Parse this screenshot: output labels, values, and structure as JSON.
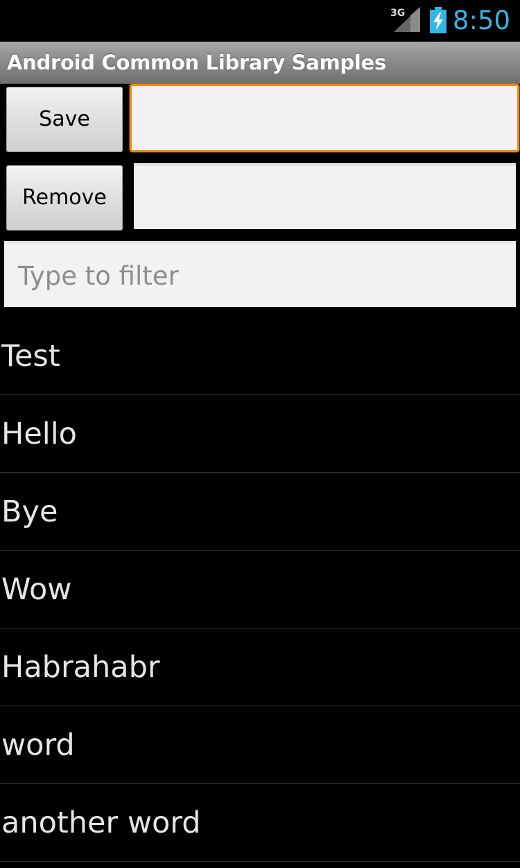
{
  "status_bar": {
    "network": "3G",
    "time": "8:50"
  },
  "app": {
    "title": "Android Common Library Samples"
  },
  "controls": {
    "save_label": "Save",
    "remove_label": "Remove",
    "save_field_value": "",
    "remove_field_value": "",
    "filter_placeholder": "Type to filter"
  },
  "list": {
    "items": [
      "Test",
      "Hello",
      "Bye",
      "Wow",
      "Habrahabr",
      "word",
      "another word"
    ]
  },
  "colors": {
    "clock": "#33b5e5",
    "focus_border": "#ff8a00"
  }
}
